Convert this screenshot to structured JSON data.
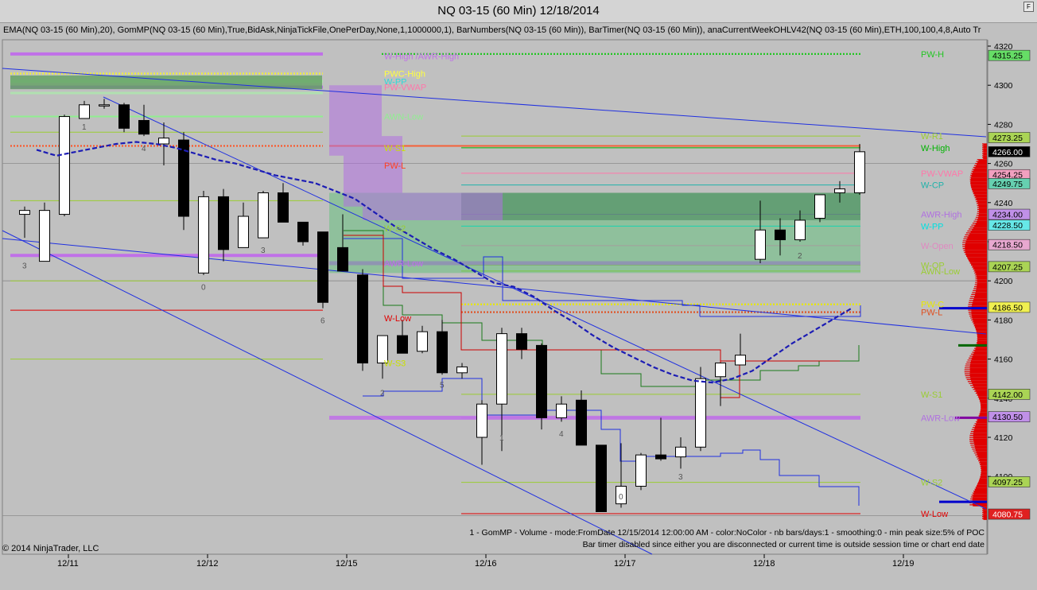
{
  "window": {
    "title": "NQ 03-15 (60 Min)  12/18/2014",
    "corner_button": "F",
    "indicators_text": "EMA(NQ 03-15 (60 Min),20), GomMP(NQ 03-15 (60 Min),True,BidAsk,NinjaTickFile,OnePerDay,None,1,1000000,1), BarNumbers(NQ 03-15 (60 Min)), BarTimer(NQ 03-15 (60 Min)), anaCurrentWeekOHLV42(NQ 03-15 (60 Min),ETH,100,100,4,8,Auto Tr",
    "footer_line1": "1 - GomMP - Volume - mode:FromDate 12/15/2014 12:00:00 AM  - color:NoColor - nb bars/days:1 - smoothing:0 - min peak size:5% of POC",
    "footer_line2": "Bar timer disabled since either you are disconnected or current time is outside session time or chart end date",
    "copyright": "© 2014 NinjaTrader, LLC"
  },
  "chart_data": {
    "type": "candlestick",
    "instrument": "NQ 03-15",
    "timeframe": "60 Min",
    "ylim": [
      4075,
      4325
    ],
    "y_ticks": [
      4320,
      4300,
      4280,
      4260,
      4240,
      4220,
      4200,
      4180,
      4160,
      4140,
      4120,
      4100
    ],
    "x_ticks": [
      {
        "label": "12/11",
        "bar": 2.2
      },
      {
        "label": "12/12",
        "bar": 9.2
      },
      {
        "label": "12/15",
        "bar": 16.2
      },
      {
        "label": "12/16",
        "bar": 23.2
      },
      {
        "label": "12/17",
        "bar": 30.2
      },
      {
        "label": "12/18",
        "bar": 37.2
      },
      {
        "label": "12/19",
        "bar": 44.2
      }
    ],
    "candles": [
      {
        "o": 4234,
        "h": 4238,
        "l": 4222,
        "c": 4236
      },
      {
        "o": 4210,
        "h": 4240,
        "l": 4214,
        "c": 4236
      },
      {
        "o": 4234,
        "h": 4285,
        "l": 4233,
        "c": 4284
      },
      {
        "o": 4283,
        "h": 4292,
        "l": 4283,
        "c": 4290
      },
      {
        "o": 4290,
        "h": 4293,
        "l": 4288,
        "c": 4290
      },
      {
        "o": 4290,
        "h": 4291,
        "l": 4276,
        "c": 4278
      },
      {
        "o": 4282,
        "h": 4290,
        "l": 4274,
        "c": 4275
      },
      {
        "o": 4270,
        "h": 4281,
        "l": 4259,
        "c": 4273
      },
      {
        "o": 4272,
        "h": 4276,
        "l": 4226,
        "c": 4233
      },
      {
        "o": 4204,
        "h": 4246,
        "l": 4203,
        "c": 4243
      },
      {
        "o": 4243,
        "h": 4247,
        "l": 4210,
        "c": 4216
      },
      {
        "o": 4217,
        "h": 4240,
        "l": 4217,
        "c": 4233
      },
      {
        "o": 4222,
        "h": 4246,
        "l": 4222,
        "c": 4245
      },
      {
        "o": 4245,
        "h": 4250,
        "l": 4230,
        "c": 4230
      },
      {
        "o": 4230,
        "h": 4230,
        "l": 4218,
        "c": 4220
      },
      {
        "o": 4225,
        "h": 4225,
        "l": 4186,
        "c": 4189
      },
      {
        "o": 4217,
        "h": 4234,
        "l": 4205,
        "c": 4205
      },
      {
        "o": 4203,
        "h": 4206,
        "l": 4154,
        "c": 4158
      },
      {
        "o": 4158,
        "h": 4166,
        "l": 4150,
        "c": 4172
      },
      {
        "o": 4172,
        "h": 4180,
        "l": 4164,
        "c": 4163
      },
      {
        "o": 4164,
        "h": 4177,
        "l": 4163,
        "c": 4174
      },
      {
        "o": 4174,
        "h": 4180,
        "l": 4152,
        "c": 4153
      },
      {
        "o": 4153,
        "h": 4158,
        "l": 4150,
        "c": 4156
      },
      {
        "o": 4120,
        "h": 4139,
        "l": 4106,
        "c": 4137
      },
      {
        "o": 4137,
        "h": 4176,
        "l": 4113,
        "c": 4173
      },
      {
        "o": 4173,
        "h": 4176,
        "l": 4160,
        "c": 4165
      },
      {
        "o": 4167,
        "h": 4168,
        "l": 4124,
        "c": 4130
      },
      {
        "o": 4130,
        "h": 4141,
        "l": 4128,
        "c": 4137
      },
      {
        "o": 4139,
        "h": 4144,
        "l": 4116,
        "c": 4116
      },
      {
        "o": 4116,
        "h": 4116,
        "l": 4082,
        "c": 4082
      },
      {
        "o": 4086,
        "h": 4117,
        "l": 4084,
        "c": 4095
      },
      {
        "o": 4095,
        "h": 4112,
        "l": 4093,
        "c": 4111
      },
      {
        "o": 4111,
        "h": 4130,
        "l": 4108,
        "c": 4109
      },
      {
        "o": 4110,
        "h": 4120,
        "l": 4104,
        "c": 4115
      },
      {
        "o": 4115,
        "h": 4156,
        "l": 4113,
        "c": 4150
      },
      {
        "o": 4151,
        "h": 4158,
        "l": 4136,
        "c": 4158
      },
      {
        "o": 4157,
        "h": 4173,
        "l": 4157,
        "c": 4162
      },
      {
        "o": 4211,
        "h": 4241,
        "l": 4209,
        "c": 4226
      },
      {
        "o": 4226,
        "h": 4232,
        "l": 4213,
        "c": 4221
      },
      {
        "o": 4221,
        "h": 4236,
        "l": 4220,
        "c": 4231
      },
      {
        "o": 4232,
        "h": 4244,
        "l": 4230,
        "c": 4244
      },
      {
        "o": 4245,
        "h": 4251,
        "l": 4240,
        "c": 4247
      },
      {
        "o": 4245,
        "h": 4270,
        "l": 4244,
        "c": 4266
      }
    ],
    "bar_numbers": [
      {
        "bar": 0,
        "label": "3",
        "price": 4208
      },
      {
        "bar": 3,
        "label": "1",
        "price": 4279
      },
      {
        "bar": 6,
        "label": "4",
        "price": 4268
      },
      {
        "bar": 9,
        "label": "0",
        "price": 4197
      },
      {
        "bar": 12,
        "label": "3",
        "price": 4216
      },
      {
        "bar": 15,
        "label": "6",
        "price": 4180
      },
      {
        "bar": 18,
        "label": "2",
        "price": 4143
      },
      {
        "bar": 21,
        "label": "5",
        "price": 4147
      },
      {
        "bar": 24,
        "label": "1",
        "price": 4120
      },
      {
        "bar": 27,
        "label": "4",
        "price": 4122
      },
      {
        "bar": 30,
        "label": "0",
        "price": 4090
      },
      {
        "bar": 33,
        "label": "3",
        "price": 4100
      },
      {
        "bar": 39,
        "label": "2",
        "price": 4213
      }
    ],
    "ema_20": [
      [
        0.6,
        4267
      ],
      [
        1.6,
        4264
      ],
      [
        2.6,
        4266
      ],
      [
        3.6,
        4268
      ],
      [
        4.6,
        4270
      ],
      [
        5.6,
        4271
      ],
      [
        6.6,
        4270
      ],
      [
        7.6,
        4268
      ],
      [
        8.6,
        4265
      ],
      [
        9.6,
        4262
      ],
      [
        10.6,
        4260
      ],
      [
        11.6,
        4257
      ],
      [
        12.6,
        4254
      ],
      [
        13.6,
        4252
      ],
      [
        14.6,
        4250
      ],
      [
        15.6,
        4246
      ],
      [
        16.6,
        4242
      ],
      [
        17.6,
        4235
      ],
      [
        18.6,
        4228
      ],
      [
        19.6,
        4222
      ],
      [
        20.6,
        4216
      ],
      [
        21.6,
        4211
      ],
      [
        22.6,
        4205
      ],
      [
        23.6,
        4199
      ],
      [
        24.6,
        4197
      ],
      [
        25.6,
        4192
      ],
      [
        26.6,
        4185
      ],
      [
        27.6,
        4179
      ],
      [
        28.6,
        4172
      ],
      [
        29.6,
        4166
      ],
      [
        30.6,
        4161
      ],
      [
        31.6,
        4156
      ],
      [
        32.6,
        4152
      ],
      [
        33.6,
        4149
      ],
      [
        34.6,
        4148
      ],
      [
        35.6,
        4150
      ],
      [
        36.6,
        4154
      ],
      [
        37.6,
        4161
      ],
      [
        38.6,
        4168
      ],
      [
        39.6,
        4174
      ],
      [
        40.6,
        4180
      ],
      [
        41.6,
        4186
      ]
    ],
    "levels": [
      {
        "name": "PW-H",
        "price": 4316,
        "color": "#22c622",
        "style": "dotted"
      },
      {
        "name": "W-R1",
        "price": 4274,
        "color": "#9acd32",
        "style": "solid"
      },
      {
        "name": "W-High",
        "price": 4268,
        "color": "#00b400",
        "style": "solid"
      },
      {
        "name": "PW-VWAP",
        "price": 4255,
        "color": "#ff77aa",
        "style": "solid"
      },
      {
        "name": "W-CP",
        "price": 4249,
        "color": "#20b2aa",
        "style": "solid"
      },
      {
        "name": "AWR-High",
        "price": 4234,
        "color": "#b070e0",
        "style": "solid"
      },
      {
        "name": "W-PP",
        "price": 4228,
        "color": "#00e0e0",
        "style": "solid"
      },
      {
        "name": "W-Open",
        "price": 4218,
        "color": "#e088c0",
        "style": "solid"
      },
      {
        "name": "W-OP",
        "price": 4208,
        "color": "#9acd32",
        "style": "solid"
      },
      {
        "name": "AWN-Low",
        "price": 4205,
        "color": "#9acd32",
        "style": "solid"
      },
      {
        "name": "PW-C",
        "price": 4188,
        "color": "#e8e800",
        "style": "dotted"
      },
      {
        "name": "PW-L",
        "price": 4184,
        "color": "#e05020",
        "style": "dotted"
      },
      {
        "name": "W-S1",
        "price": 4142,
        "color": "#9acd32",
        "style": "solid"
      },
      {
        "name": "AWR-Low",
        "price": 4130,
        "color": "#b070e0",
        "style": "solid"
      },
      {
        "name": "W-S2",
        "price": 4097,
        "color": "#9acd32",
        "style": "solid"
      },
      {
        "name": "W-Low",
        "price": 4081,
        "color": "#e00000",
        "style": "solid"
      }
    ],
    "prior_week_labels": [
      {
        "name": "W-High /AWR-High",
        "price": 4315
      },
      {
        "name": "PWC-High",
        "price": 4306
      },
      {
        "name": "W-PP",
        "price": 4302
      },
      {
        "name": "PW-VWAP",
        "price": 4299
      },
      {
        "name": "AWN-Low",
        "price": 4284
      },
      {
        "name": "W-S1",
        "price": 4268
      },
      {
        "name": "PW-L",
        "price": 4259
      },
      {
        "name": "W-S2",
        "price": 4227
      },
      {
        "name": "AWR-Low",
        "price": 4209
      },
      {
        "name": "W-Low",
        "price": 4181
      },
      {
        "name": "W-S3",
        "price": 4158
      }
    ],
    "price_markers": [
      {
        "label": "4320.00",
        "price": 4320,
        "bg": "#c0c0c0",
        "fg": "#000000"
      },
      {
        "label": "4315.25",
        "price": 4315.25,
        "bg": "#66dd66",
        "fg": "#000000"
      },
      {
        "label": "4273.25",
        "price": 4273.25,
        "bg": "#aad455",
        "fg": "#000000"
      },
      {
        "label": "4266.00",
        "price": 4266,
        "bg": "#000000",
        "fg": "#ffffff"
      },
      {
        "label": "4254.25",
        "price": 4254.25,
        "bg": "#f2a0c0",
        "fg": "#000000"
      },
      {
        "label": "4249.75",
        "price": 4249.75,
        "bg": "#66d0b0",
        "fg": "#000000"
      },
      {
        "label": "4234.00",
        "price": 4234,
        "bg": "#c090e8",
        "fg": "#000000"
      },
      {
        "label": "4228.50",
        "price": 4228.5,
        "bg": "#66e8e8",
        "fg": "#000000"
      },
      {
        "label": "4218.50",
        "price": 4218.5,
        "bg": "#e8a8d0",
        "fg": "#000000"
      },
      {
        "label": "4207.25",
        "price": 4207.25,
        "bg": "#aad455",
        "fg": "#000000"
      },
      {
        "label": "4186.50",
        "price": 4186.5,
        "bg": "#f0f050",
        "fg": "#000000"
      },
      {
        "label": "4142.00",
        "price": 4142,
        "bg": "#aad455",
        "fg": "#000000"
      },
      {
        "label": "4130.50",
        "price": 4130.5,
        "bg": "#c090e8",
        "fg": "#000000"
      },
      {
        "label": "4097.25",
        "price": 4097.25,
        "bg": "#aad455",
        "fg": "#000000"
      },
      {
        "label": "4080.75",
        "price": 4080.75,
        "bg": "#e02020",
        "fg": "#ffffff"
      }
    ],
    "colors": {
      "background": "#c0c0c0",
      "up_candle": "#ffffff",
      "down_candle": "#000000",
      "ema": "#1c1cb4",
      "trendline": "#2030e0",
      "volume_profile": "#e00000"
    }
  }
}
